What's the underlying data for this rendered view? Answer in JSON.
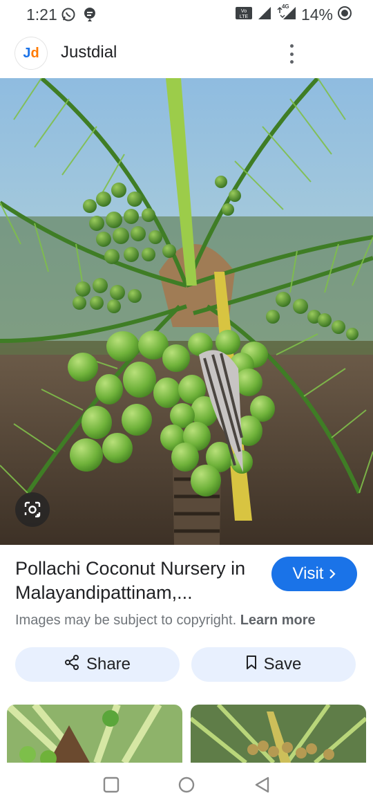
{
  "status_bar": {
    "time": "1:21",
    "battery": "14%",
    "network": "4G",
    "icons": [
      "whatsapp-icon",
      "notification-icon",
      "volte-icon",
      "signal-icon",
      "battery-icon"
    ]
  },
  "header": {
    "logo_text_j": "J",
    "logo_text_d": "d",
    "app_name": "Justdial"
  },
  "result": {
    "title": "Pollachi Coconut Nursery in Malayandipattinam,...",
    "visit_label": "Visit",
    "copyright_text": "Images may be subject to copyright.",
    "learn_more": "Learn more"
  },
  "actions": {
    "share_label": "Share",
    "save_label": "Save"
  },
  "colors": {
    "accent": "#1a73e8",
    "button_bg": "#e8f0fe"
  }
}
